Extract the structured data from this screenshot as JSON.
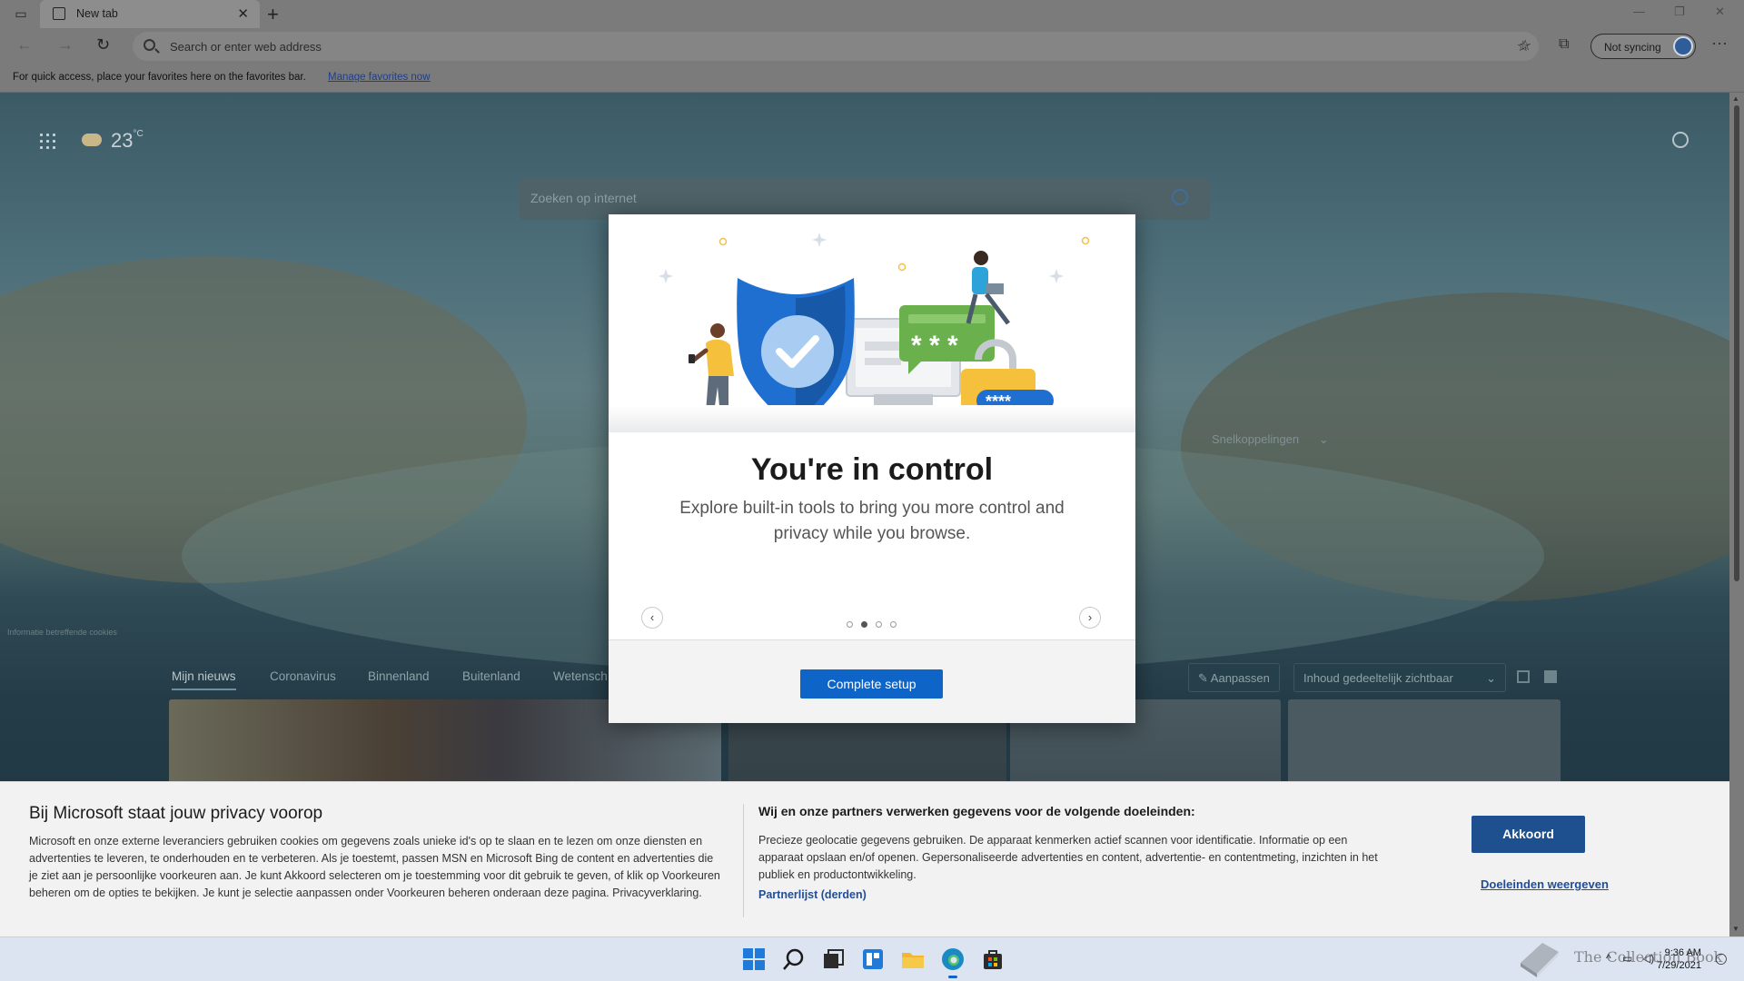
{
  "browser": {
    "tab_title": "New tab",
    "tab_close": "✕",
    "new_tab_glyph": "+",
    "address_placeholder": "Search or enter web address",
    "sync_label": "Not syncing",
    "more_glyph": "···",
    "back_glyph": "←",
    "forward_glyph": "→",
    "refresh_glyph": "↻",
    "favbar_message": "For quick access, place your favorites here on the favorites bar.",
    "favbar_link": "Manage favorites now"
  },
  "newtab": {
    "temperature": "23",
    "temp_unit": "°C",
    "search_placeholder": "Zoeken op internet",
    "shortcuts_label": "Snelkoppelingen",
    "cookie_info": "Informatie betreffende cookies",
    "news_tabs": [
      "Mijn nieuws",
      "Coronavirus",
      "Binnenland",
      "Buitenland",
      "Wetensch"
    ],
    "customize_label": "Aanpassen",
    "content_visibility_label": "Inhoud gedeeltelijk zichtbaar"
  },
  "modal": {
    "title": "You're in control",
    "subtitle": "Explore built-in tools to bring you more control and privacy while you browse.",
    "prev_glyph": "‹",
    "next_glyph": "›",
    "active_dot_index": 1,
    "dot_count": 4,
    "primary_button": "Complete setup",
    "password_mask_bubble": "* * *",
    "password_mask_pill": "****"
  },
  "privacy": {
    "title": "Bij Microsoft staat jouw privacy voorop",
    "text": "Microsoft en onze externe leveranciers gebruiken cookies om gegevens zoals unieke id's op te slaan en te lezen om onze diensten en advertenties te leveren, te onderhouden en te verbeteren. Als je toestemt, passen MSN en Microsoft Bing de content en advertenties die je ziet aan je persoonlijke voorkeuren aan. Je kunt Akkoord selecteren om je toestemming voor dit gebruik te geven, of klik op Voorkeuren beheren om de opties te bekijken. Je kunt je selectie aanpassen onder Voorkeuren beheren onderaan deze pagina. Privacyverklaring.",
    "partners_title": "Wij en onze partners verwerken gegevens voor de volgende doeleinden:",
    "partners_text": "Precieze geolocatie gegevens gebruiken. De apparaat kenmerken actief scannen voor identificatie. Informatie op een apparaat opslaan en/of openen. Gepersonaliseerde advertenties en content, advertentie- en contentmeting, inzichten in het publiek en productontwikkeling.",
    "partners_link": "Partnerlijst (derden)",
    "accept_button": "Akkoord",
    "purposes_link": "Doeleinden weergeven"
  },
  "taskbar": {
    "time": "9:36 AM",
    "date": "7/29/2021",
    "watermark": "The Collection Book"
  },
  "colors": {
    "accent": "#0f64c8",
    "privacy_button": "#1e4f8f",
    "shield_blue": "#1f6fd1",
    "bubble_green": "#6ab04c",
    "lock_yellow": "#f5c13d"
  },
  "icons": {
    "tab_actions": "tab-actions-icon",
    "search": "search-icon",
    "favorites_add": "star-plus-icon",
    "favorites": "favorites-icon",
    "collections": "collections-icon",
    "settings": "gear-icon",
    "apps": "app-launcher-icon",
    "weather": "cloudy-icon"
  }
}
